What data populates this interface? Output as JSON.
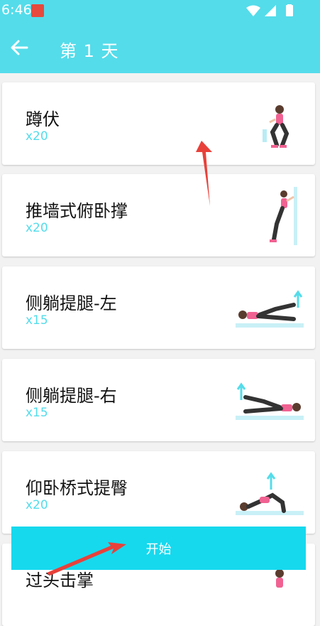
{
  "status": {
    "time": "6:46"
  },
  "header": {
    "title": "第 1 天"
  },
  "exercises": [
    {
      "name": "蹲伏",
      "reps": "x20",
      "icon": "squat-illustration-icon"
    },
    {
      "name": "推墙式俯卧撑",
      "reps": "x20",
      "icon": "wall-pushup-illustration-icon"
    },
    {
      "name": "侧躺提腿-左",
      "reps": "x15",
      "icon": "side-leg-raise-left-illustration-icon"
    },
    {
      "name": "侧躺提腿-右",
      "reps": "x15",
      "icon": "side-leg-raise-right-illustration-icon"
    },
    {
      "name": "仰卧桥式提臀",
      "reps": "x20",
      "icon": "glute-bridge-illustration-icon"
    },
    {
      "name": "过头击掌",
      "reps": "",
      "icon": "overhead-clap-illustration-icon"
    }
  ],
  "start_button": {
    "label": "开始"
  },
  "colors": {
    "accent": "#54dcea",
    "button": "#16d9ee",
    "annotation_arrow": "#e8413a"
  }
}
